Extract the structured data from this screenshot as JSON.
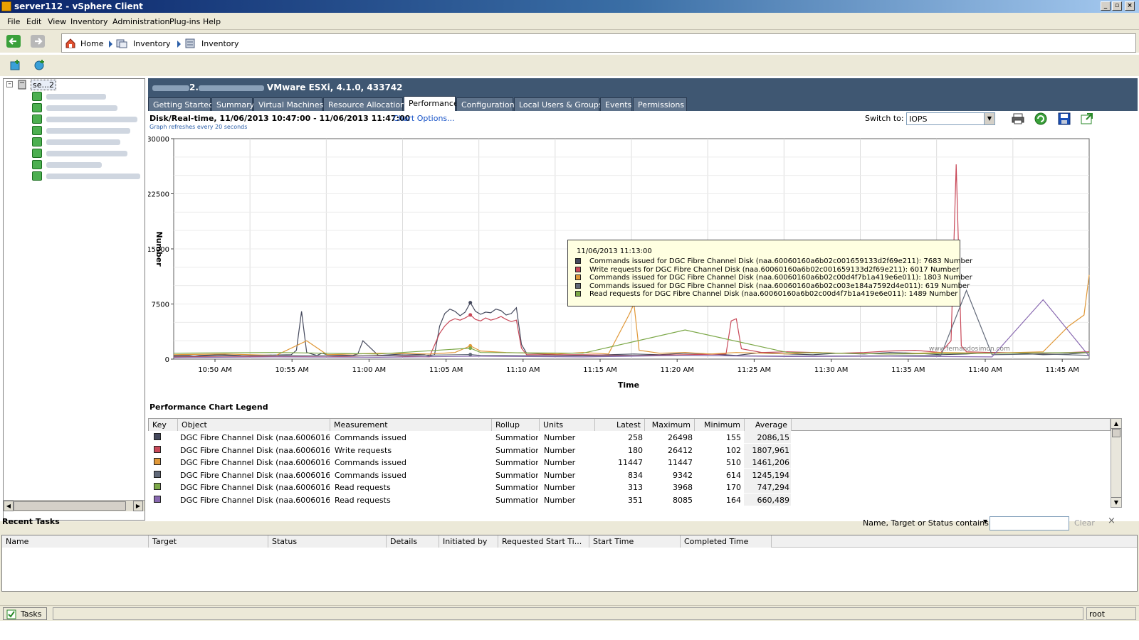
{
  "window": {
    "title": "server112 - vSphere Client"
  },
  "menu": [
    "File",
    "Edit",
    "View",
    "Inventory",
    "Administration",
    "Plug-ins",
    "Help"
  ],
  "breadcrumb": {
    "home": "Home",
    "items": [
      "Inventory",
      "Inventory"
    ]
  },
  "tree": {
    "root_label": "se...2",
    "item_count": 8
  },
  "host": {
    "name_suffix": "2.",
    "version": "VMware ESXi, 4.1.0, 433742"
  },
  "tabs": [
    "Getting Started",
    "Summary",
    "Virtual Machines",
    "Resource Allocation",
    "Performance",
    "Configuration",
    "Local Users & Groups",
    "Events",
    "Permissions"
  ],
  "active_tab": "Performance",
  "chart_header": {
    "title": "Disk/Real-time, 11/06/2013 10:47:00 - 11/06/2013 11:47:00",
    "chart_options": "Chart Options...",
    "refresh_note": "Graph refreshes every 20 seconds",
    "switch_label": "Switch to:",
    "switch_value": "IOPS"
  },
  "chart_data": {
    "type": "line",
    "ylabel": "Number",
    "xlabel": "Time",
    "ylim": [
      0,
      30000
    ],
    "yticks": [
      "30000",
      "22500",
      "15000",
      "7500",
      "0"
    ],
    "xticks": [
      "10:50 AM",
      "10:55 AM",
      "11:00 AM",
      "11:05 AM",
      "11:10 AM",
      "11:15 AM",
      "11:20 AM",
      "11:25 AM",
      "11:30 AM",
      "11:35 AM",
      "11:40 AM",
      "11:45 AM"
    ],
    "watermark": "www.fernandosimon.com",
    "series": [
      {
        "color": "#44485c",
        "x": [
          0,
          3,
          4,
          5,
          9,
          13,
          14,
          15,
          23,
          24,
          25,
          26,
          27,
          28,
          29,
          30,
          35,
          36,
          37,
          40,
          45,
          49,
          50,
          51,
          52,
          53,
          54,
          55,
          56,
          57,
          58,
          59,
          60,
          61,
          62,
          63,
          64,
          65,
          66,
          67,
          68,
          69,
          75,
          80,
          90,
          95,
          100,
          105,
          110,
          115,
          120,
          125,
          130,
          135,
          140,
          145,
          150,
          155,
          160,
          165,
          170,
          175,
          179
        ],
        "y": [
          500,
          500,
          400,
          500,
          600,
          500,
          400,
          500,
          600,
          1200,
          6500,
          900,
          700,
          500,
          800,
          600,
          500,
          700,
          2500,
          500,
          700,
          600,
          400,
          600,
          4500,
          6200,
          6800,
          6500,
          5900,
          6400,
          7683,
          6500,
          6100,
          6400,
          6300,
          6800,
          6600,
          6000,
          6200,
          7000,
          2000,
          800,
          600,
          500,
          700,
          600,
          800,
          700,
          500,
          900,
          700,
          600,
          800,
          700,
          900,
          800,
          600,
          700,
          900,
          800,
          600,
          700,
          900
        ]
      },
      {
        "color": "#c84858",
        "x": [
          0,
          10,
          20,
          30,
          40,
          50,
          52,
          53,
          54,
          55,
          56,
          57,
          58,
          59,
          60,
          61,
          62,
          63,
          64,
          65,
          66,
          67,
          68,
          69,
          80,
          90,
          100,
          108,
          109,
          110,
          111,
          115,
          120,
          130,
          135,
          140,
          145,
          150,
          152,
          153,
          154,
          155,
          160,
          170,
          175,
          179
        ],
        "y": [
          300,
          400,
          350,
          300,
          500,
          300,
          3500,
          4500,
          5200,
          5500,
          5300,
          5600,
          6017,
          5400,
          5200,
          5600,
          5300,
          5500,
          5800,
          5400,
          5100,
          5300,
          1500,
          600,
          600,
          500,
          600,
          700,
          5200,
          5500,
          1400,
          900,
          1000,
          800,
          900,
          1100,
          1200,
          900,
          2500,
          26498,
          1800,
          1000,
          900,
          800,
          900,
          1000
        ]
      },
      {
        "color": "#e09838",
        "x": [
          0,
          10,
          20,
          26,
          30,
          40,
          50,
          55,
          58,
          60,
          65,
          70,
          75,
          80,
          85,
          89,
          90,
          91,
          95,
          100,
          105,
          110,
          115,
          120,
          125,
          130,
          140,
          150,
          160,
          170,
          175,
          178,
          179
        ],
        "y": [
          600,
          700,
          500,
          2500,
          600,
          800,
          700,
          900,
          1803,
          1100,
          900,
          800,
          700,
          900,
          700,
          6000,
          7500,
          1200,
          800,
          900,
          700,
          900,
          800,
          700,
          900,
          800,
          700,
          900,
          800,
          1000,
          4500,
          6000,
          11447
        ]
      },
      {
        "color": "#606878",
        "x": [
          0,
          20,
          40,
          58,
          60,
          80,
          100,
          120,
          140,
          150,
          155,
          160,
          170,
          179
        ],
        "y": [
          400,
          500,
          450,
          619,
          500,
          450,
          500,
          400,
          450,
          500,
          9342,
          600,
          700,
          500
        ]
      },
      {
        "color": "#7ca848",
        "x": [
          0,
          20,
          40,
          58,
          60,
          80,
          100,
          120,
          140,
          160,
          179
        ],
        "y": [
          800,
          900,
          700,
          1489,
          900,
          800,
          3968,
          900,
          700,
          800,
          900
        ]
      },
      {
        "color": "#8868b0",
        "x": [
          0,
          20,
          40,
          60,
          80,
          100,
          120,
          140,
          160,
          170,
          179
        ],
        "y": [
          200,
          300,
          250,
          400,
          300,
          500,
          350,
          400,
          300,
          8085,
          400
        ]
      }
    ],
    "tooltip": {
      "time": "11/06/2013 11:13:00",
      "lines": [
        {
          "color": "#44485c",
          "text": "Commands issued for DGC Fibre Channel Disk (naa.60060160a6b02c001659133d2f69e211): 7683 Number"
        },
        {
          "color": "#c84858",
          "text": "Write requests for DGC Fibre Channel Disk (naa.60060160a6b02c001659133d2f69e211): 6017 Number"
        },
        {
          "color": "#e09838",
          "text": "Commands issued for DGC Fibre Channel Disk (naa.60060160a6b02c00d4f7b1a419e6e011): 1803 Number"
        },
        {
          "color": "#606878",
          "text": "Commands issued for DGC Fibre Channel Disk (naa.60060160a6b02c003e184a7592d4e011): 619 Number"
        },
        {
          "color": "#7ca848",
          "text": "Read requests for DGC Fibre Channel Disk (naa.60060160a6b02c00d4f7b1a419e6e011): 1489 Number"
        }
      ]
    }
  },
  "legend": {
    "title": "Performance Chart Legend",
    "columns": [
      "Key",
      "Object",
      "Measurement",
      "Rollup",
      "Units",
      "Latest",
      "Maximum",
      "Minimum",
      "Average"
    ],
    "rows": [
      {
        "color": "#44485c",
        "object": "DGC Fibre Channel Disk (naa.60060160a...",
        "measurement": "Commands issued",
        "rollup": "Summation",
        "units": "Number",
        "latest": "258",
        "maximum": "26498",
        "minimum": "155",
        "average": "2086,15"
      },
      {
        "color": "#c84858",
        "object": "DGC Fibre Channel Disk (naa.60060160a...",
        "measurement": "Write requests",
        "rollup": "Summation",
        "units": "Number",
        "latest": "180",
        "maximum": "26412",
        "minimum": "102",
        "average": "1807,961"
      },
      {
        "color": "#e09838",
        "object": "DGC Fibre Channel Disk (naa.60060160a...",
        "measurement": "Commands issued",
        "rollup": "Summation",
        "units": "Number",
        "latest": "11447",
        "maximum": "11447",
        "minimum": "510",
        "average": "1461,206"
      },
      {
        "color": "#606878",
        "object": "DGC Fibre Channel Disk (naa.60060160a...",
        "measurement": "Commands issued",
        "rollup": "Summation",
        "units": "Number",
        "latest": "834",
        "maximum": "9342",
        "minimum": "614",
        "average": "1245,194"
      },
      {
        "color": "#7ca848",
        "object": "DGC Fibre Channel Disk (naa.60060160a...",
        "measurement": "Read requests",
        "rollup": "Summation",
        "units": "Number",
        "latest": "313",
        "maximum": "3968",
        "minimum": "170",
        "average": "747,294"
      },
      {
        "color": "#8868b0",
        "object": "DGC Fibre Channel Disk (naa.60060160a...",
        "measurement": "Read requests",
        "rollup": "Summation",
        "units": "Number",
        "latest": "351",
        "maximum": "8085",
        "minimum": "164",
        "average": "660,489"
      }
    ]
  },
  "recent_tasks": {
    "title": "Recent Tasks",
    "filter_label": "Name, Target or Status contains:",
    "filter_value": "",
    "clear_label": "Clear",
    "columns": [
      "Name",
      "Target",
      "Status",
      "Details",
      "Initiated by",
      "Requested Start Ti...",
      "Start Time",
      "Completed Time"
    ]
  },
  "statusbar": {
    "tasks_label": "Tasks",
    "user": "root"
  }
}
